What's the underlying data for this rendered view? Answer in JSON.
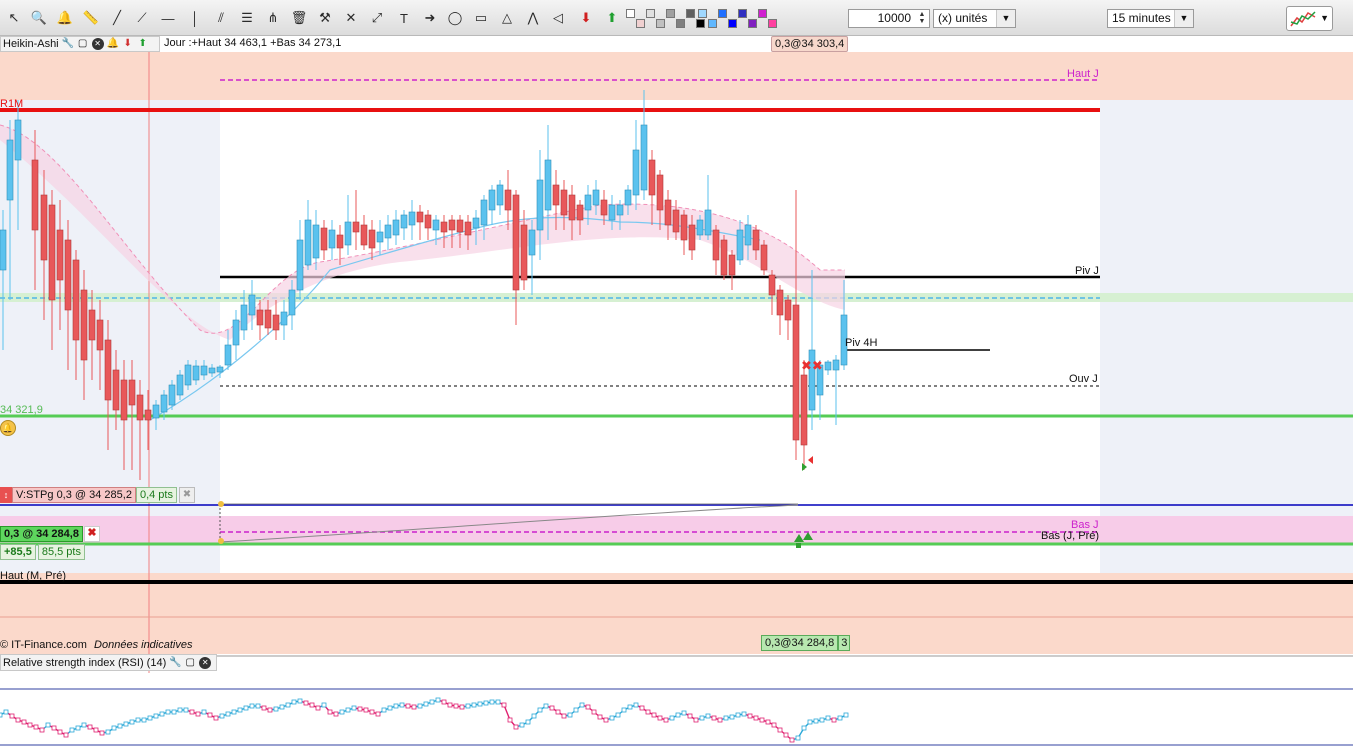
{
  "toolbar": {
    "tools": [
      "pointer-icon",
      "zoom-icon",
      "bell-icon",
      "ruler-icon",
      "line-icon",
      "ray-icon",
      "horizontal-line-icon",
      "vertical-line-icon",
      "channel-icon",
      "fibonacci-icon",
      "andrews-pitchfork-icon",
      "trash-icon",
      "tools-icon",
      "cross-line-icon",
      "extended-line-icon",
      "text-icon",
      "arrow-icon",
      "ellipse-icon",
      "rectangle-icon",
      "triangle-icon",
      "zigzag-icon",
      "wedge-icon",
      "arrow-down-icon",
      "arrow-up-icon"
    ],
    "quantity": "10000",
    "unit_select": "(x) unités",
    "timeframe_select": "15 minutes",
    "swatch_colors": [
      "#ffffff",
      "#f0d0d0",
      "#e0e0e0",
      "#c0c0c0",
      "#a0a0a0",
      "#808080",
      "#606060",
      "#000000",
      "#a0d8ff",
      "#60b8ff",
      "#2070ff",
      "#0000ff",
      "#3030c0",
      "#8020c0",
      "#d020d0",
      "#ff40a0"
    ]
  },
  "header": {
    "chart_type": "Heikin-Ashi",
    "day_info": "Jour :+Haut 34 463,1 +Bas 34 273,1",
    "top_badge": "0,3@34 303,4"
  },
  "levels": {
    "r1m": "R1M",
    "haut_j": "Haut J",
    "piv_j": "Piv J",
    "piv_4h": "Piv 4H",
    "ouv_j": "Ouv J",
    "price_321": "34 321,9",
    "bas_j": "Bas J",
    "bas_j_pre": "Bas (J, Pré)",
    "haut_m_pre": "Haut (M, Pré)"
  },
  "orders": {
    "stop_label": "V:STPg",
    "stop_value": "0,3 @ 34 285,2",
    "stop_pts": "0,4 pts",
    "position_value": "0,3 @ 34 284,8",
    "position_pnl": "+85,5",
    "position_pts": "85,5 pts"
  },
  "footer": {
    "credit": "© IT-Finance.com",
    "disclaimer": "Données indicatives",
    "bottom_badge": "0,3@34 284,8",
    "bottom_badge_extra": "3"
  },
  "rsi": {
    "title": "Relative strength index (RSI) (14)"
  },
  "colors": {
    "up_candle": "#5bc2ee",
    "down_candle": "#e8585a",
    "r1m_line": "#e81010",
    "pivot_line": "#000000",
    "support_line": "#55cc55",
    "haut_bas_line": "#cc22cc",
    "salmon_zone": "#fbd9cb"
  },
  "chart_data": {
    "type": "candlestick",
    "timeframe": "15 minutes",
    "ylim": [
      34270,
      34470
    ],
    "reference_levels": [
      {
        "name": "R1M"
      },
      {
        "name": "Haut J",
        "value": 34463.1
      },
      {
        "name": "Bas J",
        "value": 34273.1
      },
      {
        "name": "",
        "value": 34321.9
      },
      {
        "name": "Position",
        "value": 34284.8
      },
      {
        "name": "Stop",
        "value": 34285.2
      }
    ]
  }
}
